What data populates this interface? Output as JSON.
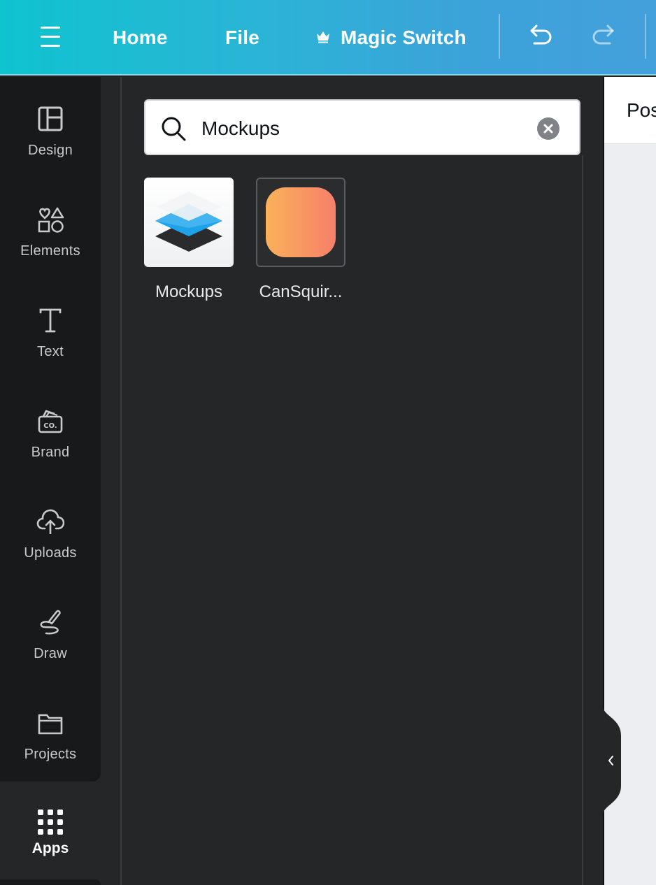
{
  "topbar": {
    "nav": {
      "home": "Home",
      "file": "File",
      "magic_switch": "Magic Switch"
    },
    "icons": {
      "menu": "hamburger-menu-icon",
      "crown": "crown-icon",
      "undo": "undo-icon",
      "redo": "redo-icon"
    },
    "gradient_colors": [
      "#0fc3cf",
      "#44a0db"
    ]
  },
  "sidebar": {
    "items": [
      {
        "label": "Design",
        "icon": "layout-icon"
      },
      {
        "label": "Elements",
        "icon": "shapes-icon"
      },
      {
        "label": "Text",
        "icon": "text-icon"
      },
      {
        "label": "Brand",
        "icon": "brand-icon"
      },
      {
        "label": "Uploads",
        "icon": "cloud-upload-icon"
      },
      {
        "label": "Draw",
        "icon": "pen-draw-icon"
      },
      {
        "label": "Projects",
        "icon": "folder-icon"
      },
      {
        "label": "Apps",
        "icon": "apps-grid-icon",
        "active": true
      }
    ]
  },
  "search": {
    "value": "Mockups",
    "icon": "search-icon",
    "clear_icon": "clear-icon"
  },
  "apps": [
    {
      "name": "Mockups",
      "icon": "mockups-layers-icon"
    },
    {
      "name": "CanSquir...",
      "icon": "cansquircle-icon"
    }
  ],
  "canvas": {
    "header_text": "Pos"
  },
  "colors": {
    "rail_bg": "#18191b",
    "panel_bg": "#252627",
    "cansq_gradient": [
      "#fbb15a",
      "#f6806a"
    ]
  }
}
